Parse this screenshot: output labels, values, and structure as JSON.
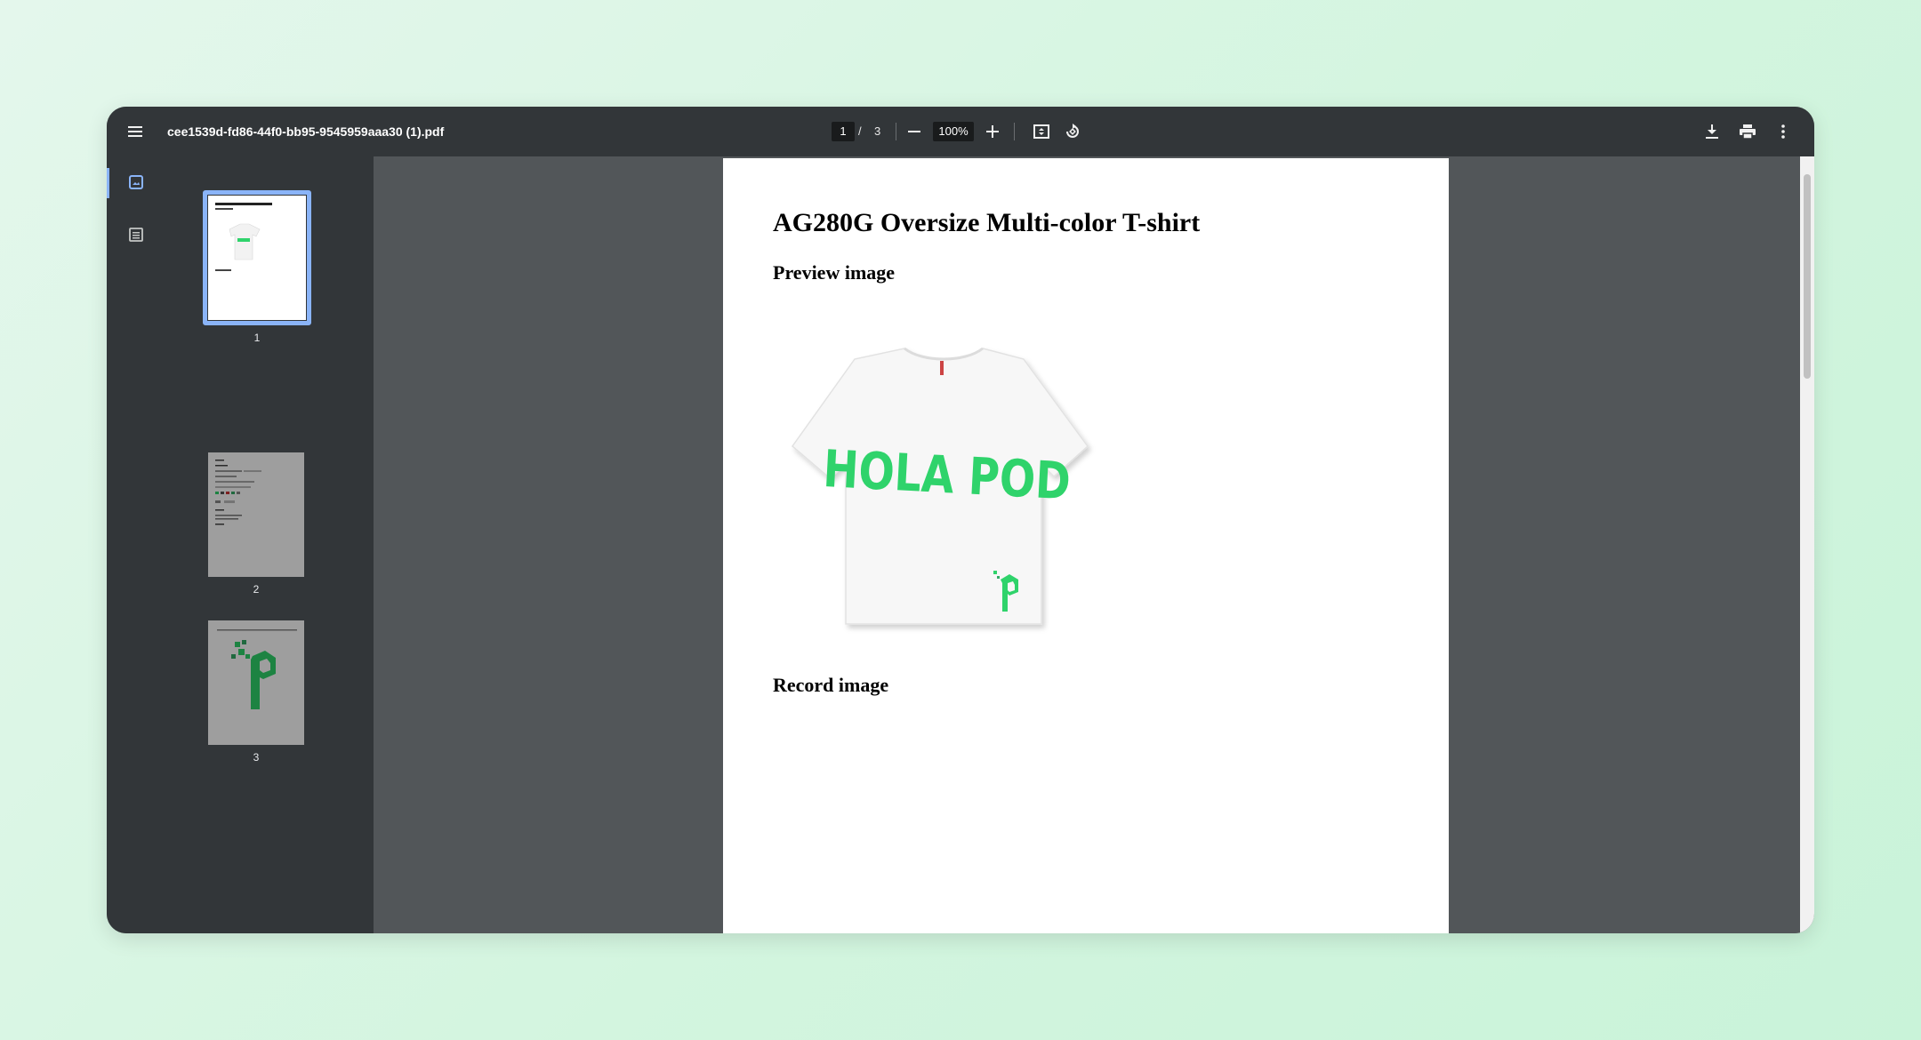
{
  "toolbar": {
    "filename": "cee1539d-fd86-44f0-bb95-9545959aaa30 (1).pdf",
    "current_page": "1",
    "page_separator": "/",
    "total_pages": "3",
    "zoom": "100%"
  },
  "icons": {
    "menu": "menu-icon",
    "zoom_out": "minus-icon",
    "zoom_in": "plus-icon",
    "fit": "fit-to-page-icon",
    "rotate": "rotate-icon",
    "download": "download-icon",
    "print": "print-icon",
    "more": "more-vert-icon",
    "thumbnails": "thumbnails-icon",
    "outline": "outline-icon"
  },
  "thumbnails": [
    {
      "label": "1"
    },
    {
      "label": "2"
    },
    {
      "label": "3"
    }
  ],
  "document": {
    "title": "AG280G Oversize Multi-color T-shirt",
    "preview_heading": "Preview image",
    "shirt_print": "HOLA POD",
    "record_heading": "Record image"
  },
  "colors": {
    "accent": "#8ab4f8",
    "brand_green": "#2fd36b",
    "toolbar_bg": "#323639",
    "viewer_bg": "#525659"
  }
}
